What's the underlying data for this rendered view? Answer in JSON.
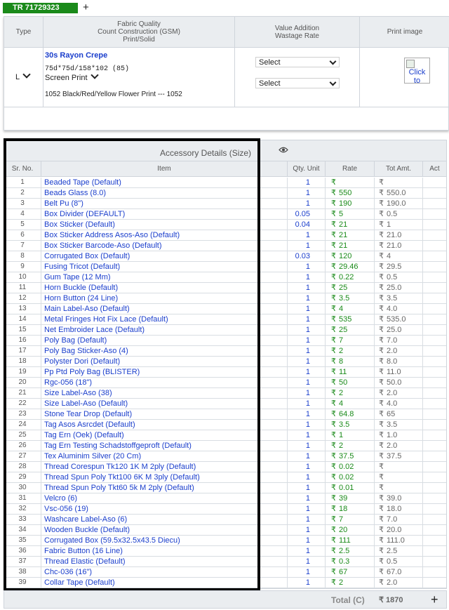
{
  "tab": {
    "label": "TR 71729323",
    "add": "+"
  },
  "fabric_header": {
    "type": "Type",
    "quality": [
      "Fabric Quality",
      "Count Construction (GSM)",
      "Print/Solid"
    ],
    "value_add": [
      "Value Addition",
      "Wastage Rate"
    ],
    "print_image": "Print image"
  },
  "fabric": {
    "type_value": "L",
    "name": "30s Rayon Crepe",
    "count": "75d*75d/158*102  (85)",
    "print_type": "Screen Print",
    "color": "1052 Black/Red/Yellow Flower Print --- 1052",
    "select1": "Select",
    "select2": "Select",
    "image_alt": "Click to"
  },
  "accessory": {
    "title": "Accessory Details (Size)",
    "columns": {
      "sr": "Sr. No.",
      "item": "Item",
      "qty": "Qty. Unit",
      "rate": "Rate",
      "amt": "Tot Amt.",
      "act": "Act"
    },
    "currency": "₹",
    "rows": [
      {
        "sr": "1",
        "item": "Beaded Tape (Default)",
        "qty": "1",
        "rate": "",
        "amt": ""
      },
      {
        "sr": "2",
        "item": "Beads Glass (8.0)",
        "qty": "1",
        "rate": "550",
        "amt": "550.0"
      },
      {
        "sr": "3",
        "item": "Belt Pu (8\")",
        "qty": "1",
        "rate": "190",
        "amt": "190.0"
      },
      {
        "sr": "4",
        "item": "Box Divider (DEFAULT)",
        "qty": "0.05",
        "rate": "5",
        "amt": "0.5"
      },
      {
        "sr": "5",
        "item": "Box Sticker (Default)",
        "qty": "0.04",
        "rate": "21",
        "amt": "1"
      },
      {
        "sr": "6",
        "item": "Box Sticker Address Asos-Aso (Default)",
        "qty": "1",
        "rate": "21",
        "amt": "21.0"
      },
      {
        "sr": "7",
        "item": "Box Sticker Barcode-Aso (Default)",
        "qty": "1",
        "rate": "21",
        "amt": "21.0"
      },
      {
        "sr": "8",
        "item": "Corrugated Box (Default)",
        "qty": "0.03",
        "rate": "120",
        "amt": "4"
      },
      {
        "sr": "9",
        "item": "Fusing Tricot (Default)",
        "qty": "1",
        "rate": "29.46",
        "amt": "29.5"
      },
      {
        "sr": "10",
        "item": "Gum Tape (12 Mm)",
        "qty": "1",
        "rate": "0.22",
        "amt": "0.5"
      },
      {
        "sr": "11",
        "item": "Horn Buckle (Default)",
        "qty": "1",
        "rate": "25",
        "amt": "25.0"
      },
      {
        "sr": "12",
        "item": "Horn Button (24 Line)",
        "qty": "1",
        "rate": "3.5",
        "amt": "3.5"
      },
      {
        "sr": "13",
        "item": "Main Label-Aso (Default)",
        "qty": "1",
        "rate": "4",
        "amt": "4.0"
      },
      {
        "sr": "14",
        "item": "Metal Fringes Hot Fix Lace (Default)",
        "qty": "1",
        "rate": "535",
        "amt": "535.0"
      },
      {
        "sr": "15",
        "item": "Net Embroider Lace (Default)",
        "qty": "1",
        "rate": "25",
        "amt": "25.0"
      },
      {
        "sr": "16",
        "item": "Poly Bag (Default)",
        "qty": "1",
        "rate": "7",
        "amt": "7.0"
      },
      {
        "sr": "17",
        "item": "Poly Bag Sticker-Aso (4)",
        "qty": "1",
        "rate": "2",
        "amt": "2.0"
      },
      {
        "sr": "18",
        "item": "Polyster Dori (Default)",
        "qty": "1",
        "rate": "8",
        "amt": "8.0"
      },
      {
        "sr": "19",
        "item": "Pp Ptd Poly Bag (BLISTER)",
        "qty": "1",
        "rate": "11",
        "amt": "11.0"
      },
      {
        "sr": "20",
        "item": "Rgc-056 (18\")",
        "qty": "1",
        "rate": "50",
        "amt": "50.0"
      },
      {
        "sr": "21",
        "item": "Size Label-Aso (38)",
        "qty": "1",
        "rate": "2",
        "amt": "2.0"
      },
      {
        "sr": "22",
        "item": "Size Label-Aso (Default)",
        "qty": "1",
        "rate": "4",
        "amt": "4.0"
      },
      {
        "sr": "23",
        "item": "Stone Tear Drop (Default)",
        "qty": "1",
        "rate": "64.8",
        "amt": "65"
      },
      {
        "sr": "24",
        "item": "Tag Asos Asrcdet (Default)",
        "qty": "1",
        "rate": "3.5",
        "amt": "3.5"
      },
      {
        "sr": "25",
        "item": "Tag Ern (Oek) (Default)",
        "qty": "1",
        "rate": "1",
        "amt": "1.0"
      },
      {
        "sr": "26",
        "item": "Tag Ern Testing Schadstoffgeproft (Default)",
        "qty": "1",
        "rate": "2",
        "amt": "2.0"
      },
      {
        "sr": "27",
        "item": "Tex Aluminim Silver (20 Cm)",
        "qty": "1",
        "rate": "37.5",
        "amt": "37.5"
      },
      {
        "sr": "28",
        "item": "Thread Corespun Tk120 1K M 2ply (Default)",
        "qty": "1",
        "rate": "0.02",
        "amt": ""
      },
      {
        "sr": "29",
        "item": "Thread Spun Poly Tkt100 6K M 3ply (Default)",
        "qty": "1",
        "rate": "0.02",
        "amt": ""
      },
      {
        "sr": "30",
        "item": "Thread Spun Poly Tkt60 5k M 2ply (Default)",
        "qty": "1",
        "rate": "0.01",
        "amt": ""
      },
      {
        "sr": "31",
        "item": "Velcro (6)",
        "qty": "1",
        "rate": "39",
        "amt": "39.0"
      },
      {
        "sr": "32",
        "item": "Vsc-056 (19)",
        "qty": "1",
        "rate": "18",
        "amt": "18.0"
      },
      {
        "sr": "33",
        "item": "Washcare Label-Aso (6)",
        "qty": "1",
        "rate": "7",
        "amt": "7.0"
      },
      {
        "sr": "34",
        "item": "Wooden Buckle (Default)",
        "qty": "1",
        "rate": "20",
        "amt": "20.0"
      },
      {
        "sr": "35",
        "item": "Corrugated Box (59.5x32.5x43.5 Diecu)",
        "qty": "1",
        "rate": "111",
        "amt": "111.0"
      },
      {
        "sr": "36",
        "item": "Fabric Button (16 Line)",
        "qty": "1",
        "rate": "2.5",
        "amt": "2.5"
      },
      {
        "sr": "37",
        "item": "Thread Elastic (Default)",
        "qty": "1",
        "rate": "0.3",
        "amt": "0.5"
      },
      {
        "sr": "38",
        "item": "Chc-036 (16\")",
        "qty": "1",
        "rate": "67",
        "amt": "67.0"
      },
      {
        "sr": "39",
        "item": "Collar Tape (Default)",
        "qty": "1",
        "rate": "2",
        "amt": "2.0"
      }
    ],
    "total_label": "Total (C)",
    "total_value": "₹ 1870",
    "add": "+"
  }
}
